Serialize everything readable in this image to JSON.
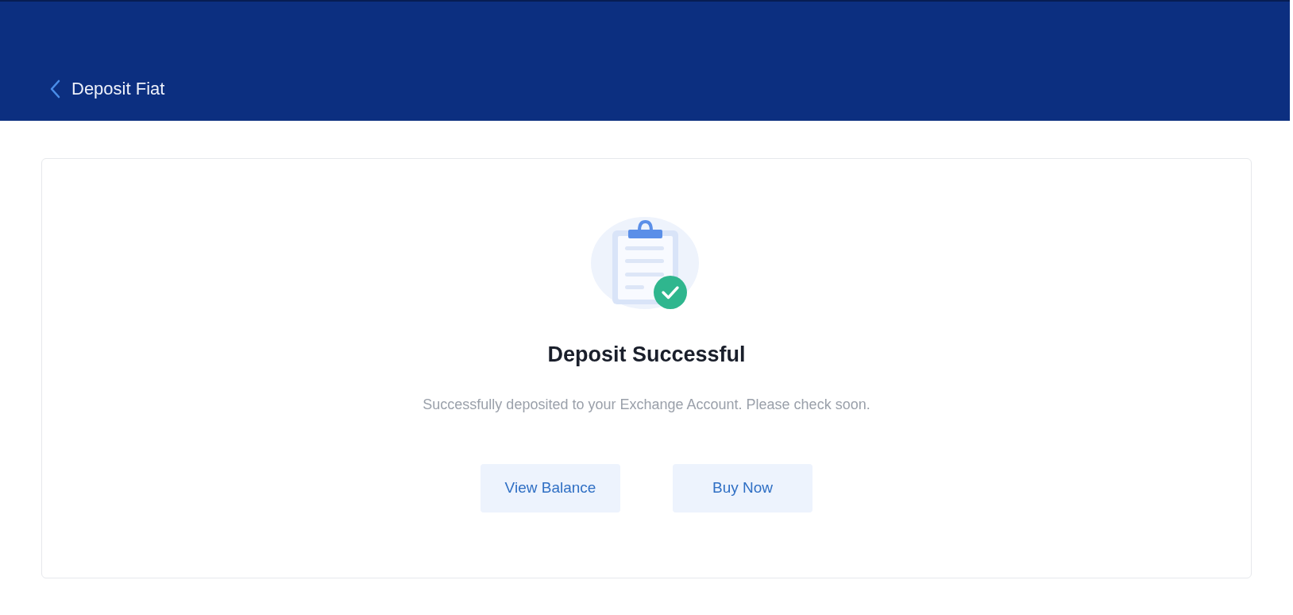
{
  "header": {
    "title": "Deposit Fiat"
  },
  "result": {
    "title": "Deposit Successful",
    "message": "Successfully deposited to your Exchange Account. Please check soon.",
    "buttons": [
      {
        "label": "View Balance"
      },
      {
        "label": "Buy Now"
      }
    ]
  }
}
